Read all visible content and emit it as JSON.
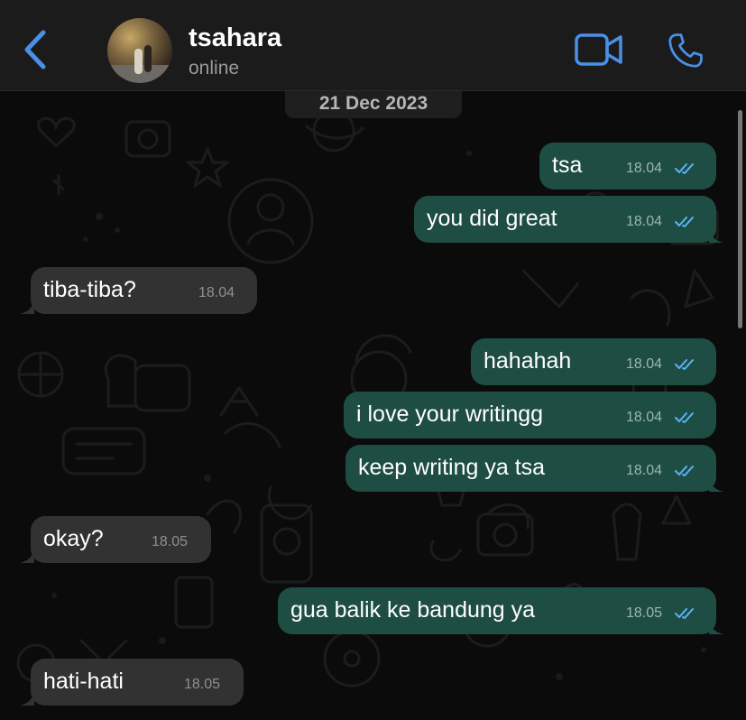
{
  "header": {
    "contact_name": "tsahara",
    "status": "online"
  },
  "colors": {
    "accent": "#4a8fe8",
    "outgoing_bubble": "#1e4d43",
    "incoming_bubble": "#323232",
    "read_ticks": "#5ab3f5"
  },
  "icons": [
    "chevron-left-icon",
    "video-camera-icon",
    "phone-icon",
    "double-check-icon"
  ],
  "chat": {
    "date_label": "21 Dec 2023",
    "messages": [
      {
        "direction": "out",
        "text": "tsa",
        "time": "18.04",
        "read": true
      },
      {
        "direction": "out",
        "text": "you did great",
        "time": "18.04",
        "read": true
      },
      {
        "direction": "in",
        "text": "tiba-tiba?",
        "time": "18.04"
      },
      {
        "direction": "out",
        "text": "hahahah",
        "time": "18.04",
        "read": true
      },
      {
        "direction": "out",
        "text": "i love your writingg",
        "time": "18.04",
        "read": true
      },
      {
        "direction": "out",
        "text": "keep writing ya tsa",
        "time": "18.04",
        "read": true
      },
      {
        "direction": "in",
        "text": "okay?",
        "time": "18.05"
      },
      {
        "direction": "out",
        "text": "gua balik ke bandung ya",
        "time": "18.05",
        "read": true
      },
      {
        "direction": "in",
        "text": "hati-hati",
        "time": "18.05"
      }
    ]
  }
}
